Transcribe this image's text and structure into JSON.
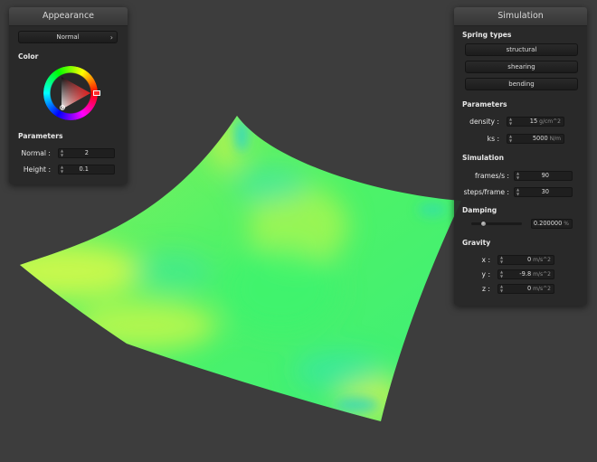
{
  "viewport": {
    "cloth_colors": {
      "green": "#4cf568",
      "yellow": "#c6f84a",
      "cyan": "#33e3b2"
    }
  },
  "appearance": {
    "title": "Appearance",
    "shader_select": "Normal",
    "color_label": "Color",
    "color_wheel": {
      "selected_hue": "#ff2020",
      "triangle_tip": "#e11b1b"
    },
    "parameters_label": "Parameters",
    "normal_label": "Normal :",
    "normal_value": "2",
    "height_label": "Height :",
    "height_value": "0.1"
  },
  "simulation": {
    "title": "Simulation",
    "spring_types_label": "Spring types",
    "spring_buttons": [
      "structural",
      "shearing",
      "bending"
    ],
    "parameters_label": "Parameters",
    "density_label": "density :",
    "density_value": "15",
    "density_unit": "g/cm^2",
    "ks_label": "ks :",
    "ks_value": "5000",
    "ks_unit": "N/m",
    "simulation_label": "Simulation",
    "frames_label": "frames/s :",
    "frames_value": "90",
    "steps_label": "steps/frame :",
    "steps_value": "30",
    "damping_label": "Damping",
    "damping_value": "0.200000",
    "damping_unit": "%",
    "damping_level": 0.2,
    "gravity_label": "Gravity",
    "gravity_x_label": "x :",
    "gravity_x_value": "0",
    "gravity_y_label": "y :",
    "gravity_y_value": "-9.8",
    "gravity_z_label": "z :",
    "gravity_z_value": "0",
    "gravity_unit": "m/s^2"
  }
}
